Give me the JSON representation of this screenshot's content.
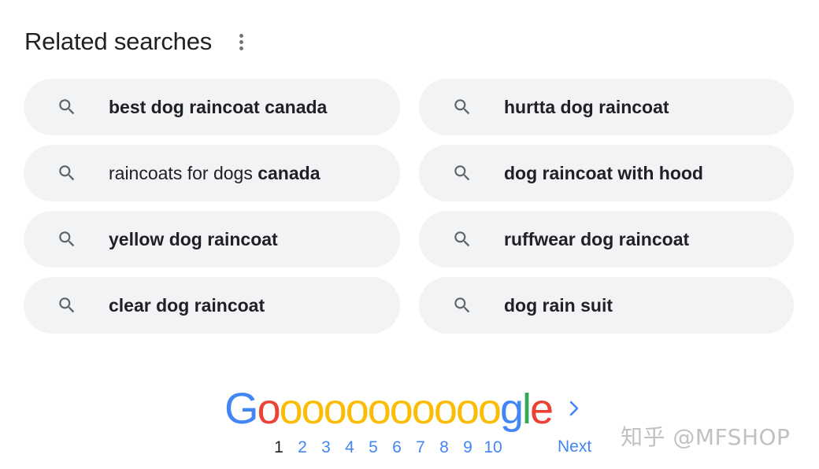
{
  "related": {
    "title": "Related searches",
    "menu_icon": "more-vert-icon",
    "items": [
      {
        "regular": "",
        "bold": "best dog raincoat canada",
        "icon": "search-icon"
      },
      {
        "regular": "",
        "bold": "hurtta dog raincoat",
        "icon": "search-icon"
      },
      {
        "regular": "raincoats for dogs ",
        "bold": "canada",
        "icon": "search-icon"
      },
      {
        "regular": "",
        "bold": "dog raincoat with hood",
        "icon": "search-icon"
      },
      {
        "regular": "",
        "bold": "yellow dog raincoat",
        "icon": "search-icon"
      },
      {
        "regular": "",
        "bold": "ruffwear dog raincoat",
        "icon": "search-icon"
      },
      {
        "regular": "",
        "bold": "clear dog raincoat",
        "icon": "search-icon"
      },
      {
        "regular": "",
        "bold": "dog rain suit",
        "icon": "search-icon"
      }
    ]
  },
  "pagination": {
    "logo": {
      "G": "G",
      "o_first": "o",
      "o_rest": "oooooooooo",
      "g": "g",
      "l": "l",
      "e": "e"
    },
    "pages": [
      "1",
      "2",
      "3",
      "4",
      "5",
      "6",
      "7",
      "8",
      "9",
      "10"
    ],
    "current_page": "1",
    "next_label": "Next",
    "next_icon": "chevron-right-icon"
  },
  "colors": {
    "blue": "#4285f4",
    "red": "#ea4335",
    "yellow": "#fbbc05",
    "green": "#34a853",
    "chip_bg": "#f1f3f4",
    "text": "#202124"
  },
  "watermark": "知乎 @MFSHOP"
}
